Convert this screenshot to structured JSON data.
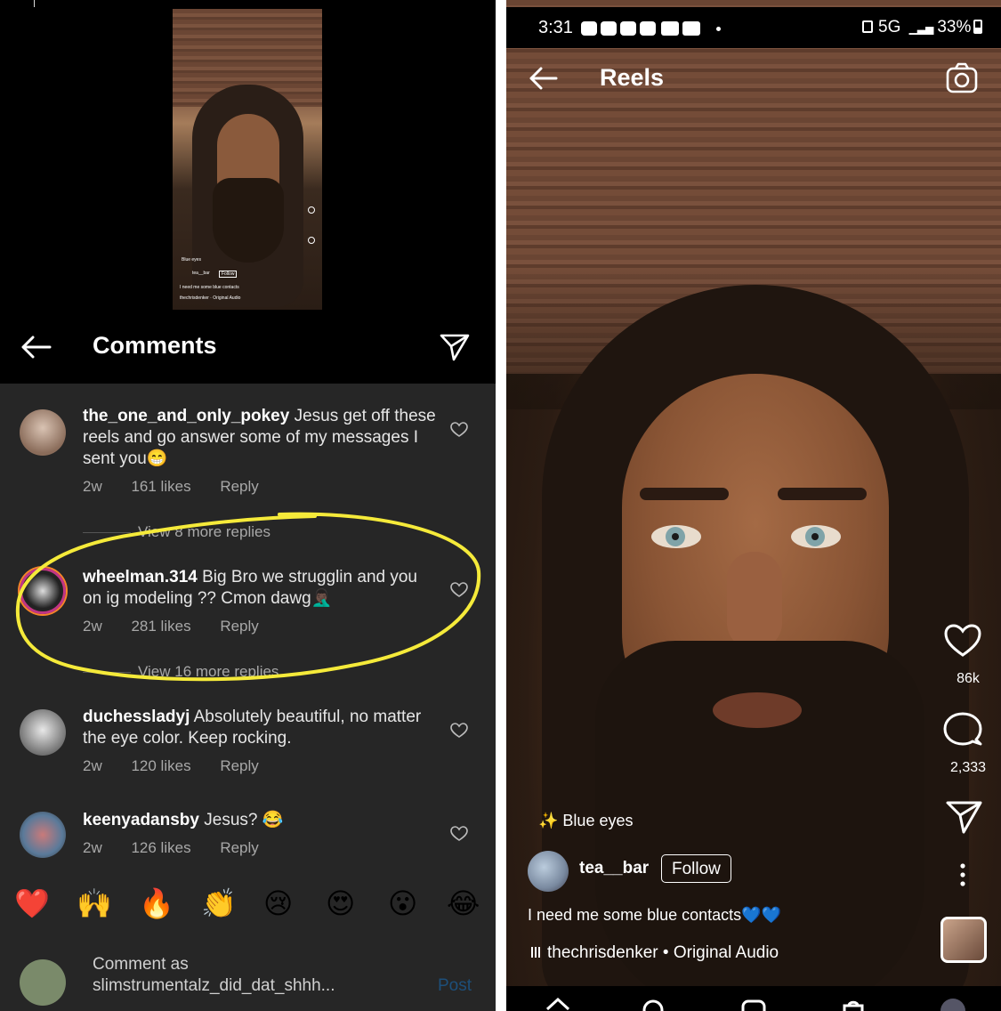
{
  "left_panel": {
    "thumbnail": {
      "effect": "Blue eyes",
      "owner": "tea__bar",
      "follow": "Follow",
      "caption": "I need me some blue contacts",
      "audio": "thechrisdenker · Original Audio"
    },
    "header": {
      "title": "Comments"
    },
    "comments": [
      {
        "username": "the_one_and_only_pokey",
        "text": "Jesus get off these reels and go answer some of my messages I sent you😁",
        "age": "2w",
        "likes": "161 likes",
        "reply": "Reply",
        "view_more": "View 8 more replies"
      },
      {
        "username": "wheelman.314",
        "text": "Big Bro we strugglin and you on ig modeling ?? Cmon dawg🤦🏿‍♂️",
        "age": "2w",
        "likes": "281 likes",
        "reply": "Reply",
        "view_more": "View 16 more replies",
        "highlighted": true
      },
      {
        "username": "duchessladyj",
        "text": "Absolutely beautiful, no matter the eye color. Keep rocking.",
        "age": "2w",
        "likes": "120 likes",
        "reply": "Reply"
      },
      {
        "username": "keenyadansby",
        "text": "Jesus? 😂",
        "age": "2w",
        "likes": "126 likes",
        "reply": "Reply"
      }
    ],
    "emoji_bar": [
      "❤️",
      "🙌",
      "🔥",
      "👏",
      "😢",
      "😍",
      "😮",
      "😂"
    ],
    "composer": {
      "placeholder": "Comment as slimstrumentalz_did_dat_shhh...",
      "post": "Post"
    },
    "colors": {
      "highlight": "#f5ea3a",
      "background": "#262626",
      "post_disabled": "#1d4f7a"
    }
  },
  "right_panel": {
    "status_bar": {
      "time": "3:31",
      "network": "5G",
      "battery": "33%"
    },
    "header": {
      "title": "Reels"
    },
    "actions": {
      "likes": "86k",
      "comments": "2,333"
    },
    "effect": "Blue eyes",
    "owner": "tea__bar",
    "follow": "Follow",
    "caption": "I need me some blue contacts💙💙",
    "audio": "thechrisdenker • Original Audio"
  }
}
